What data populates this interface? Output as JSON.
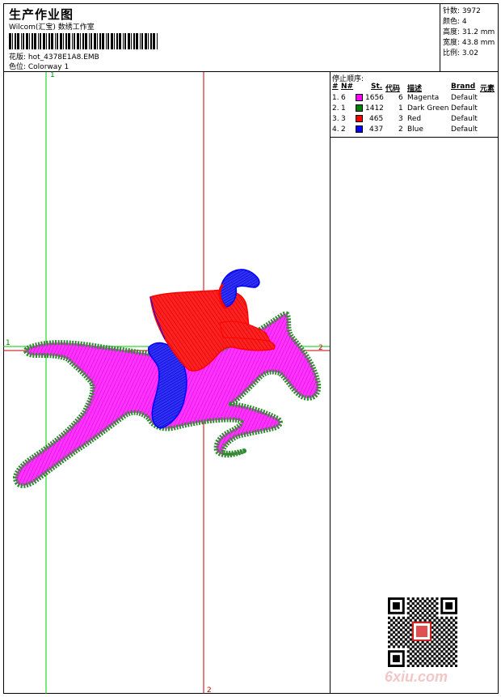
{
  "header": {
    "title": "生产作业图",
    "subtitle": "Wilcom(汇宝) 数绣工作室",
    "design_label": "花版: hot_4378E1A8.EMB",
    "colorway_label": "色位: Colorway 1"
  },
  "stats": {
    "stitches": "针数: 3972",
    "colors": "颜色: 4",
    "height": "高度: 31.2 mm",
    "width": "宽度: 43.8 mm",
    "scale": "比例: 3.02"
  },
  "legend": {
    "title": "停止顺序:",
    "headers": {
      "num": "#",
      "n": "N#",
      "st": "St.",
      "code": "代码",
      "desc": "描述",
      "brand": "Brand",
      "elem": "元素"
    },
    "rows": [
      {
        "index": "1.",
        "n": "6",
        "stitches": "1656",
        "code": "6",
        "desc": "Magenta",
        "brand": "Default",
        "color": "#ff00ff"
      },
      {
        "index": "2.",
        "n": "1",
        "stitches": "1412",
        "code": "1",
        "desc": "Dark Green",
        "brand": "Default",
        "color": "#008000"
      },
      {
        "index": "3.",
        "n": "3",
        "stitches": "465",
        "code": "3",
        "desc": "Red",
        "brand": "Default",
        "color": "#ff0000"
      },
      {
        "index": "4.",
        "n": "2",
        "stitches": "437",
        "code": "2",
        "desc": "Blue",
        "brand": "Default",
        "color": "#0000ff"
      }
    ]
  },
  "axes": {
    "green_top": "1",
    "green_left": "1",
    "red_right": "2",
    "red_bottom": "2"
  },
  "watermark": "6xiu.com",
  "colors": {
    "magenta": "#ff00ff",
    "green": "#2e8b2e",
    "red": "#ff0000",
    "blue": "#0000ff",
    "guide_green": "#00cc00",
    "guide_red": "#cc0000"
  }
}
